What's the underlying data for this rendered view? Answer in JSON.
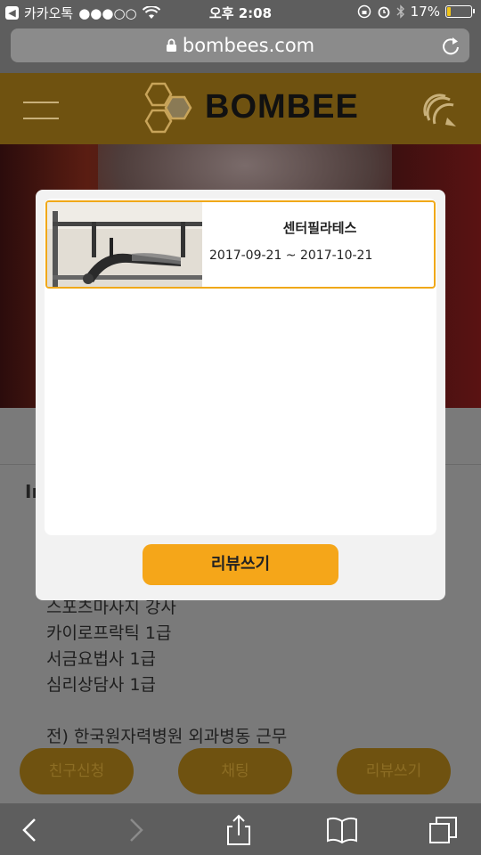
{
  "status_bar": {
    "back_app": "카카오톡",
    "signal": "●●●○○",
    "time": "오후 2:08",
    "battery": "17%",
    "battery_level": 0.17,
    "battery_color": "#f0c419"
  },
  "browser": {
    "url": "bombees.com",
    "lock_icon": "lock-icon",
    "reload_icon": "reload-icon"
  },
  "header": {
    "brand": "BOMBEE",
    "menu_icon": "hamburger-icon",
    "chat_icon": "chat-icon",
    "bg_color": "#6f5210"
  },
  "background": {
    "section_title": "In",
    "lines": [
      "스포츠마사지 강사",
      "카이로프락틱 1급",
      "서금요법사 1급",
      "심리상담사 1급",
      "",
      "전) 한국원자력병원 외과병동 근무"
    ],
    "buttons": [
      "친구신청",
      "채팅",
      "리뷰쓰기"
    ]
  },
  "modal": {
    "item": {
      "title": "센터필라테스",
      "date_range": "2017-09-21 ~  2017-10-21"
    },
    "review_button": "리뷰쓰기",
    "accent": "#f5a619"
  },
  "toolbar": {
    "icons": [
      "back-icon",
      "forward-icon",
      "share-icon",
      "bookmarks-icon",
      "tabs-icon"
    ]
  }
}
